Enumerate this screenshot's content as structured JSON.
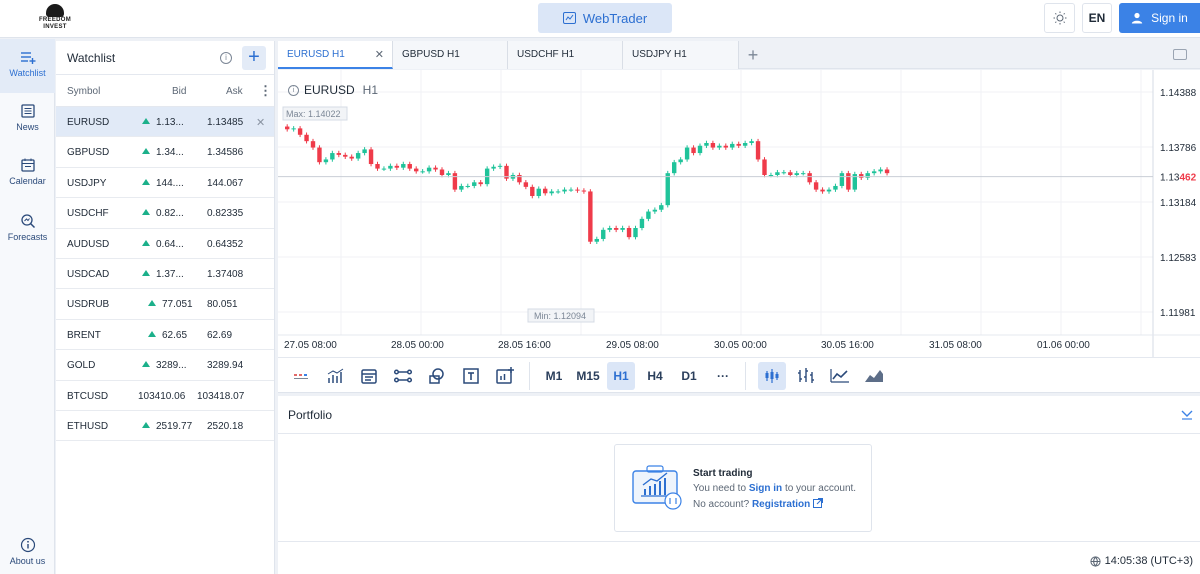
{
  "header": {
    "logo_line1": "FREEDOM",
    "logo_line2": "INVEST",
    "webtrader_label": "WebTrader",
    "lang_label": "EN",
    "signin_label": "Sign in"
  },
  "nav": {
    "items": [
      {
        "label": "Watchlist",
        "icon": "watchlist-icon"
      },
      {
        "label": "News",
        "icon": "news-icon"
      },
      {
        "label": "Calendar",
        "icon": "calendar-icon"
      },
      {
        "label": "Forecasts",
        "icon": "forecasts-icon"
      }
    ],
    "about_label": "About us"
  },
  "watchlist": {
    "title": "Watchlist",
    "col_symbol": "Symbol",
    "col_bid": "Bid",
    "col_ask": "Ask",
    "rows": [
      {
        "symbol": "EURUSD",
        "bid": "1.13...",
        "ask": "1.13485"
      },
      {
        "symbol": "GBPUSD",
        "bid": "1.34...",
        "ask": "1.34586"
      },
      {
        "symbol": "USDJPY",
        "bid": "144....",
        "ask": "144.067"
      },
      {
        "symbol": "USDCHF",
        "bid": "0.82...",
        "ask": "0.82335"
      },
      {
        "symbol": "AUDUSD",
        "bid": "0.64...",
        "ask": "0.64352"
      },
      {
        "symbol": "USDCAD",
        "bid": "1.37...",
        "ask": "1.37408"
      },
      {
        "symbol": "USDRUB",
        "bid": "77.051",
        "ask": "80.051"
      },
      {
        "symbol": "BRENT",
        "bid": "62.65",
        "ask": "62.69"
      },
      {
        "symbol": "GOLD",
        "bid": "3289...",
        "ask": "3289.94"
      },
      {
        "symbol": "BTCUSD",
        "bid": "103410.06",
        "ask": "103418.07"
      },
      {
        "symbol": "ETHUSD",
        "bid": "2519.77",
        "ask": "2520.18"
      }
    ]
  },
  "tabs": [
    {
      "label": "EURUSD H1"
    },
    {
      "label": "GBPUSD H1"
    },
    {
      "label": "USDCHF H1"
    },
    {
      "label": "USDJPY H1"
    }
  ],
  "chart": {
    "symbol": "EURUSD",
    "timeframe": "H1",
    "max_label": "Max: 1.14022",
    "min_label": "Min: 1.12094",
    "current_price_prefix": "1.13",
    "current_price_suffix": "462",
    "price_ticks": [
      "1.14388",
      "1.13786",
      "1.13184",
      "1.12583",
      "1.11981"
    ],
    "time_ticks": [
      "27.05 08:00",
      "28.05 00:00",
      "28.05 16:00",
      "29.05 08:00",
      "30.05 00:00",
      "30.05 16:00",
      "31.05 08:00",
      "01.06 00:00"
    ],
    "colors": {
      "up": "#1fc39a",
      "down": "#ef3b4a",
      "accent": "#3b82e6"
    }
  },
  "chart_data": {
    "type": "candlestick",
    "title": "EURUSD H1",
    "ylim": [
      1.1175,
      1.1445
    ],
    "y_ticks": [
      1.14388,
      1.13786,
      1.13184,
      1.12583,
      1.11981
    ],
    "x_ticks": [
      "27.05 08:00",
      "28.05 00:00",
      "28.05 16:00",
      "29.05 08:00",
      "30.05 00:00",
      "30.05 16:00",
      "31.05 08:00",
      "01.06 00:00"
    ],
    "max": 1.14022,
    "min": 1.12094,
    "last": 1.13462,
    "closes": [
      1.1398,
      1.1399,
      1.1392,
      1.1385,
      1.1378,
      1.1362,
      1.1365,
      1.1372,
      1.137,
      1.1368,
      1.1366,
      1.1372,
      1.1376,
      1.136,
      1.1355,
      1.1355,
      1.1358,
      1.1356,
      1.136,
      1.1355,
      1.1352,
      1.1352,
      1.1356,
      1.1354,
      1.1348,
      1.135,
      1.1332,
      1.1336,
      1.1336,
      1.134,
      1.1338,
      1.1355,
      1.1357,
      1.1358,
      1.1344,
      1.1348,
      1.134,
      1.1335,
      1.1325,
      1.1333,
      1.1328,
      1.133,
      1.133,
      1.1332,
      1.1332,
      1.1331,
      1.133,
      1.1275,
      1.1278,
      1.1288,
      1.129,
      1.1288,
      1.129,
      1.128,
      1.129,
      1.13,
      1.1308,
      1.131,
      1.1315,
      1.135,
      1.1362,
      1.1365,
      1.1378,
      1.1372,
      1.138,
      1.1383,
      1.1378,
      1.138,
      1.1378,
      1.1382,
      1.138,
      1.1383,
      1.1385,
      1.1365,
      1.1348,
      1.1348,
      1.1351,
      1.1351,
      1.1348,
      1.135,
      1.135,
      1.134,
      1.1332,
      1.133,
      1.1332,
      1.1336,
      1.135,
      1.1332,
      1.1349,
      1.1345,
      1.135,
      1.1352,
      1.1354,
      1.135
    ]
  },
  "toolbar": {
    "timeframes": [
      "M1",
      "M15",
      "H1",
      "H4",
      "D1"
    ],
    "active_timeframe": "H1",
    "more_label": "···"
  },
  "portfolio": {
    "title": "Portfolio",
    "start_title": "Start trading",
    "need_prefix": "You need to",
    "signin_link": "Sign in",
    "need_suffix": "to your account.",
    "noaccount": "No account?",
    "registration_link": "Registration"
  },
  "status": {
    "clock": "14:05:38 (UTC+3)"
  }
}
